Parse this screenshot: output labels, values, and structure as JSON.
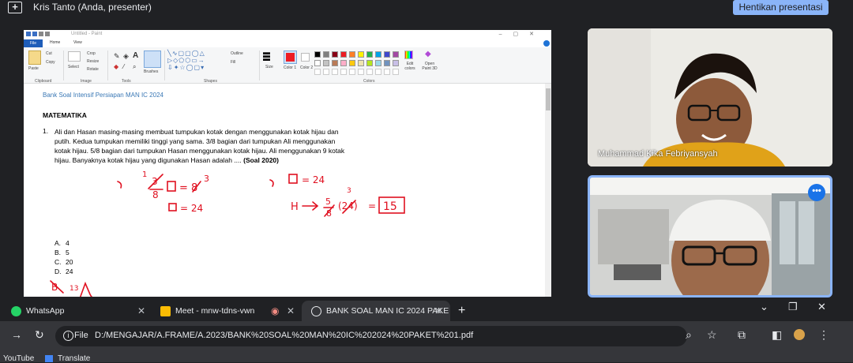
{
  "meet": {
    "presenter": "Kris Tanto (Anda, presenter)",
    "stop_button": "Hentikan presentasi"
  },
  "paint": {
    "window_title": "Untitled - Paint",
    "tabs": [
      "File",
      "Home",
      "View"
    ],
    "groups": [
      "Clipboard",
      "Image",
      "Tools",
      "Shapes",
      "Colors"
    ],
    "ribbon_labels": {
      "cut": "Cut",
      "copy": "Copy",
      "paste": "Paste",
      "select": "Select",
      "crop": "Crop",
      "resize": "Resize",
      "rotate": "Rotate",
      "brushes": "Brushes",
      "outline": "Outline",
      "fill": "Fill",
      "size": "Size",
      "color1": "Color 1",
      "color2": "Color 2",
      "edit_colors": "Edit colors",
      "open_paint3d": "Open Paint 3D"
    },
    "palette": [
      "#000000",
      "#7f7f7f",
      "#880015",
      "#ed1c24",
      "#ff7f27",
      "#fff200",
      "#22b14c",
      "#00a2e8",
      "#3f48cc",
      "#a349a4",
      "#ffffff",
      "#c3c3c3",
      "#b97a57",
      "#ffaec9",
      "#ffc90e",
      "#efe4b0",
      "#b5e61d",
      "#99d9ea",
      "#7092be",
      "#c8bfe7"
    ],
    "color1": "#ed1c24"
  },
  "document": {
    "header": "Bank Soal Intensif Persiapan MAN IC 2024",
    "subject": "MATEMATIKA",
    "number": "1.",
    "question": "Ali dan Hasan masing-masing membuat tumpukan kotak dengan menggunakan kotak hijau dan putih. Kedua tumpukan memiliki tinggi yang sama. 3/8 bagian dari tumpukan Ali menggunakan kotak hijau. 5/8 bagian dari tumpukan Hasan menggunakan kotak hijau. Ali menggunakan 9 kotak hijau. Banyaknya kotak hijau yang digunakan Hasan adalah .... ",
    "source": "(Soal 2020)",
    "options": [
      {
        "key": "A.",
        "value": "4"
      },
      {
        "key": "B.",
        "value": "5"
      },
      {
        "key": "C.",
        "value": "20"
      },
      {
        "key": "D.",
        "value": "24"
      }
    ]
  },
  "participants": [
    {
      "name": "Muhammad Kika Febriyansyah"
    },
    {
      "name": ""
    }
  ],
  "browser": {
    "tabs": [
      {
        "title": "WhatsApp",
        "icon": "whatsapp-icon"
      },
      {
        "title": "Meet - mnw-tdns-vwn",
        "icon": "meet-icon"
      },
      {
        "title": "BANK SOAL MAN IC 2024 PAKE",
        "icon": "globe-icon"
      }
    ],
    "url_scheme": "File",
    "url": "D:/MENGAJAR/A.FRAME/A.2023/BANK%20SOAL%20MAN%20IC%202024%20PAKET%201.pdf",
    "bookmarks": [
      "YouTube",
      "Translate"
    ]
  }
}
